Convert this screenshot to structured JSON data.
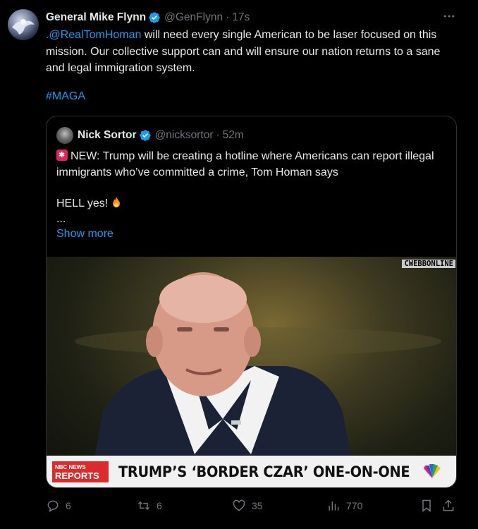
{
  "tweet": {
    "author_name": "General Mike Flynn",
    "author_handle": "@GenFlynn",
    "separator": "·",
    "time": "17s",
    "mention": ".@RealTomHoman",
    "text_after_mention": " will need every single American to be laser focused on this mission. Our collective support can and will ensure our nation returns to a sane and legal immigration system.",
    "hashtag": "#MAGA",
    "more_icon": "more-icon",
    "accent_color": "#1d9bf0"
  },
  "quote": {
    "author_name": "Nick Sortor",
    "author_handle": "@nicksortor",
    "separator": "·",
    "time": "52m",
    "line1": "NEW: Trump will be creating a hotline where Americans can report illegal immigrants who’ve committed a crime, Tom Homan says",
    "line2": "HELL yes!",
    "ellipsis": "...",
    "show_more": "Show more",
    "media": {
      "watermark": "CWEBBONLINE",
      "banner_logo_top": "NBC NEWS",
      "banner_logo_bottom": "REPORTS",
      "banner_title": "TRUMP’S ‘BORDER CZAR’ ONE-ON-ONE"
    }
  },
  "actions": {
    "replies": "6",
    "reposts": "6",
    "likes": "35",
    "views": "770"
  }
}
